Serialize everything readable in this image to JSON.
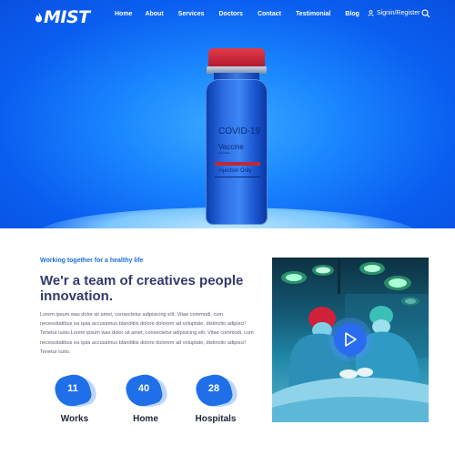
{
  "brand": {
    "logo_text": "MIST"
  },
  "nav": {
    "items": [
      "Home",
      "About",
      "Services",
      "Doctors",
      "Contact",
      "Testimonial",
      "Blog"
    ],
    "signin_label": "Signin/Register"
  },
  "hero": {
    "vial": {
      "title": "COVID-19",
      "subtitle": "Vaccine",
      "small_text": "injectable",
      "band_text": "Injection Only"
    }
  },
  "about": {
    "kicker": "Working together for a healthy life",
    "headline": "We'r a team of creatives people innovation.",
    "paragraph": "Lorem ipsum was dolor sit amet, consectetur adipisicing elit. Vitae commodi, cum necessitatibus ea quia accusamus blanditiis dolore dolorem ad voluptate, distinctio adipisci! Tenetur iusto.Lorem ipsum was dolor sit amet, consectetur adipisicing elit. Vitae commodi, cum necessitatibus ea quia accusamus blanditiis dolore dolorem ad voluptate, distinctio adipisci! Tenetur iusto."
  },
  "stats": [
    {
      "value": "11",
      "label": "Works"
    },
    {
      "value": "40",
      "label": "Home"
    },
    {
      "value": "28",
      "label": "Hospitals"
    }
  ],
  "colors": {
    "accent": "#1f6fe8",
    "heading": "#343a6b",
    "cap_red": "#c0283a"
  }
}
